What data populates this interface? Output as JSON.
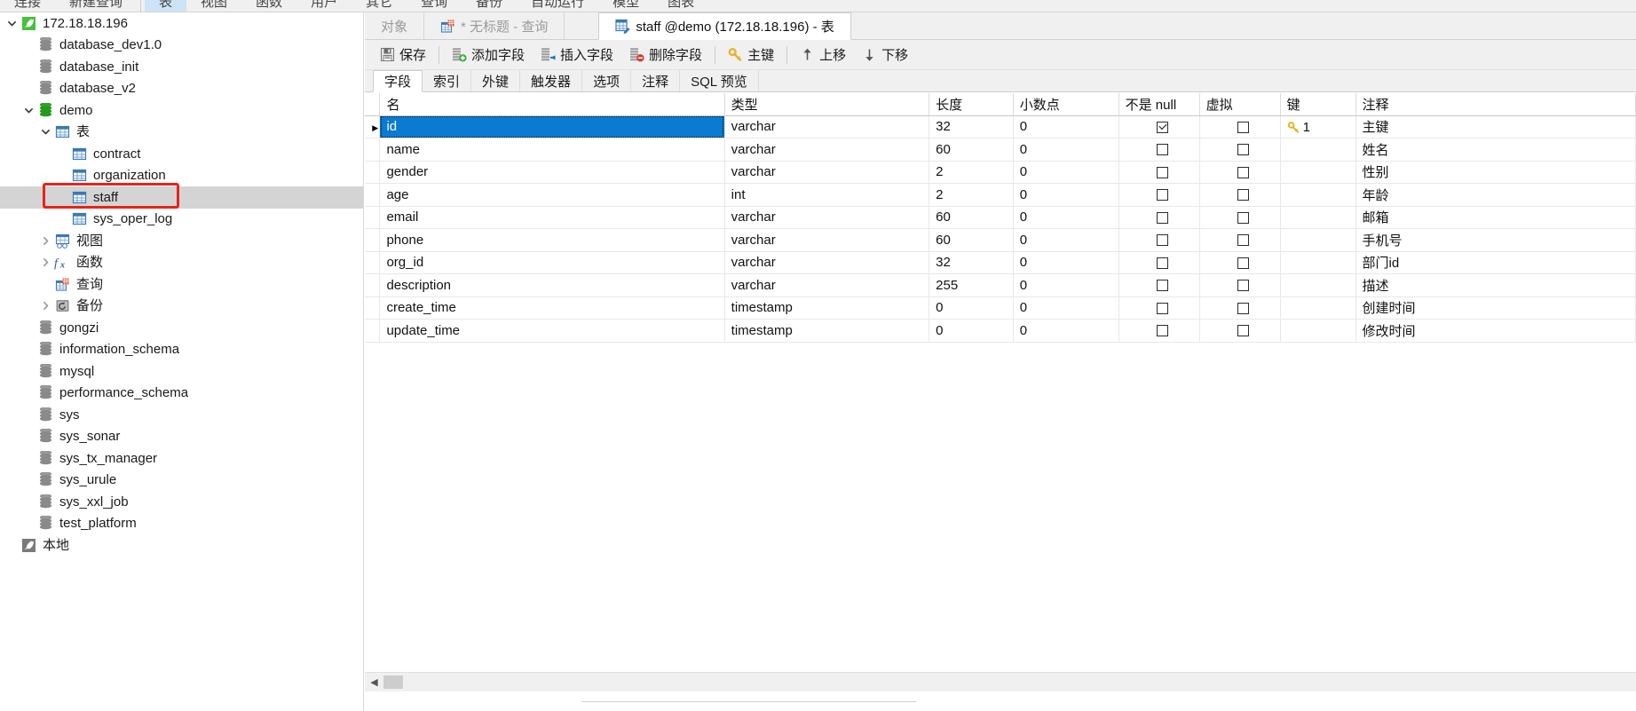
{
  "ribbon": {
    "items": [
      {
        "label": "连接",
        "active": false
      },
      {
        "label": "新建查询",
        "active": false
      },
      {
        "label": "表",
        "active": true
      },
      {
        "label": "视图",
        "active": false
      },
      {
        "label": "函数",
        "active": false
      },
      {
        "label": "用户",
        "active": false
      },
      {
        "label": "其它",
        "active": false
      },
      {
        "label": "查询",
        "active": false
      },
      {
        "label": "备份",
        "active": false
      },
      {
        "label": "自动运行",
        "active": false
      },
      {
        "label": "模型",
        "active": false
      },
      {
        "label": "图表",
        "active": false
      }
    ]
  },
  "sidebar": {
    "items": [
      {
        "label": "172.18.18.196",
        "depth": 0,
        "icon": "navicat-connection-icon",
        "twisty": "down",
        "selected": false
      },
      {
        "label": "database_dev1.0",
        "depth": 1,
        "icon": "database-icon",
        "twisty": "none",
        "selected": false
      },
      {
        "label": "database_init",
        "depth": 1,
        "icon": "database-icon",
        "twisty": "none",
        "selected": false
      },
      {
        "label": "database_v2",
        "depth": 1,
        "icon": "database-icon",
        "twisty": "none",
        "selected": false
      },
      {
        "label": "demo",
        "depth": 1,
        "icon": "database-open-icon",
        "twisty": "down",
        "selected": false
      },
      {
        "label": "表",
        "depth": 2,
        "icon": "table-folder-icon",
        "twisty": "down",
        "selected": false
      },
      {
        "label": "contract",
        "depth": 3,
        "icon": "table-icon",
        "twisty": "none",
        "selected": false
      },
      {
        "label": "organization",
        "depth": 3,
        "icon": "table-icon",
        "twisty": "none",
        "selected": false
      },
      {
        "label": "staff",
        "depth": 3,
        "icon": "table-icon",
        "twisty": "none",
        "selected": true
      },
      {
        "label": "sys_oper_log",
        "depth": 3,
        "icon": "table-icon",
        "twisty": "none",
        "selected": false
      },
      {
        "label": "视图",
        "depth": 2,
        "icon": "view-icon",
        "twisty": "right",
        "selected": false
      },
      {
        "label": "函数",
        "depth": 2,
        "icon": "function-icon",
        "twisty": "right",
        "selected": false
      },
      {
        "label": "查询",
        "depth": 2,
        "icon": "query-icon",
        "twisty": "none",
        "selected": false
      },
      {
        "label": "备份",
        "depth": 2,
        "icon": "backup-icon",
        "twisty": "right",
        "selected": false
      },
      {
        "label": "gongzi",
        "depth": 1,
        "icon": "database-icon",
        "twisty": "none",
        "selected": false
      },
      {
        "label": "information_schema",
        "depth": 1,
        "icon": "database-icon",
        "twisty": "none",
        "selected": false
      },
      {
        "label": "mysql",
        "depth": 1,
        "icon": "database-icon",
        "twisty": "none",
        "selected": false
      },
      {
        "label": "performance_schema",
        "depth": 1,
        "icon": "database-icon",
        "twisty": "none",
        "selected": false
      },
      {
        "label": "sys",
        "depth": 1,
        "icon": "database-icon",
        "twisty": "none",
        "selected": false
      },
      {
        "label": "sys_sonar",
        "depth": 1,
        "icon": "database-icon",
        "twisty": "none",
        "selected": false
      },
      {
        "label": "sys_tx_manager",
        "depth": 1,
        "icon": "database-icon",
        "twisty": "none",
        "selected": false
      },
      {
        "label": "sys_urule",
        "depth": 1,
        "icon": "database-icon",
        "twisty": "none",
        "selected": false
      },
      {
        "label": "sys_xxl_job",
        "depth": 1,
        "icon": "database-icon",
        "twisty": "none",
        "selected": false
      },
      {
        "label": "test_platform",
        "depth": 1,
        "icon": "database-icon",
        "twisty": "none",
        "selected": false
      },
      {
        "label": "本地",
        "depth": 0,
        "icon": "navicat-connection-gray-icon",
        "twisty": "none",
        "selected": false
      }
    ]
  },
  "tabbar": {
    "tabs": [
      {
        "label": "对象",
        "icon": "",
        "active": false,
        "muted": true
      },
      {
        "label": "* 无标题 - 查询",
        "icon": "query-tab-icon",
        "active": false,
        "muted": true
      },
      {
        "label": "staff @demo (172.18.18.196) - 表",
        "icon": "table-design-icon",
        "active": true,
        "muted": false
      }
    ]
  },
  "toolbar": {
    "buttons": [
      {
        "label": "保存",
        "icon": "save-icon"
      },
      {
        "label": "添加字段",
        "icon": "add-field-icon"
      },
      {
        "label": "插入字段",
        "icon": "insert-field-icon"
      },
      {
        "label": "删除字段",
        "icon": "delete-field-icon"
      },
      {
        "label": "主键",
        "icon": "primary-key-icon"
      },
      {
        "label": "上移",
        "icon": "move-up-icon"
      },
      {
        "label": "下移",
        "icon": "move-down-icon"
      }
    ]
  },
  "subtabs": [
    {
      "label": "字段",
      "active": true
    },
    {
      "label": "索引",
      "active": false
    },
    {
      "label": "外键",
      "active": false
    },
    {
      "label": "触发器",
      "active": false
    },
    {
      "label": "选项",
      "active": false
    },
    {
      "label": "注释",
      "active": false
    },
    {
      "label": "SQL 预览",
      "active": false
    }
  ],
  "grid": {
    "columns": [
      "名",
      "类型",
      "长度",
      "小数点",
      "不是 null",
      "虚拟",
      "键",
      "注释"
    ],
    "rows": [
      {
        "name": "id",
        "type": "varchar",
        "length": "32",
        "decimals": "0",
        "not_null": true,
        "virtual": false,
        "key": "1",
        "comment": "主键",
        "selected": true
      },
      {
        "name": "name",
        "type": "varchar",
        "length": "60",
        "decimals": "0",
        "not_null": false,
        "virtual": false,
        "key": "",
        "comment": "姓名",
        "selected": false
      },
      {
        "name": "gender",
        "type": "varchar",
        "length": "2",
        "decimals": "0",
        "not_null": false,
        "virtual": false,
        "key": "",
        "comment": "性别",
        "selected": false
      },
      {
        "name": "age",
        "type": "int",
        "length": "2",
        "decimals": "0",
        "not_null": false,
        "virtual": false,
        "key": "",
        "comment": "年龄",
        "selected": false
      },
      {
        "name": "email",
        "type": "varchar",
        "length": "60",
        "decimals": "0",
        "not_null": false,
        "virtual": false,
        "key": "",
        "comment": "邮箱",
        "selected": false
      },
      {
        "name": "phone",
        "type": "varchar",
        "length": "60",
        "decimals": "0",
        "not_null": false,
        "virtual": false,
        "key": "",
        "comment": "手机号",
        "selected": false
      },
      {
        "name": "org_id",
        "type": "varchar",
        "length": "32",
        "decimals": "0",
        "not_null": false,
        "virtual": false,
        "key": "",
        "comment": "部门id",
        "selected": false
      },
      {
        "name": "description",
        "type": "varchar",
        "length": "255",
        "decimals": "0",
        "not_null": false,
        "virtual": false,
        "key": "",
        "comment": "描述",
        "selected": false
      },
      {
        "name": "create_time",
        "type": "timestamp",
        "length": "0",
        "decimals": "0",
        "not_null": false,
        "virtual": false,
        "key": "",
        "comment": "创建时间",
        "selected": false
      },
      {
        "name": "update_time",
        "type": "timestamp",
        "length": "0",
        "decimals": "0",
        "not_null": false,
        "virtual": false,
        "key": "",
        "comment": "修改时间",
        "selected": false
      }
    ]
  },
  "colors": {
    "selection_blue": "#0b7ad1",
    "highlight_red": "#e8231a",
    "tree_selected_gray": "#d4d4d4",
    "ribbon_active_blue": "#cde3f7",
    "key_yellow": "#e8b32a"
  }
}
